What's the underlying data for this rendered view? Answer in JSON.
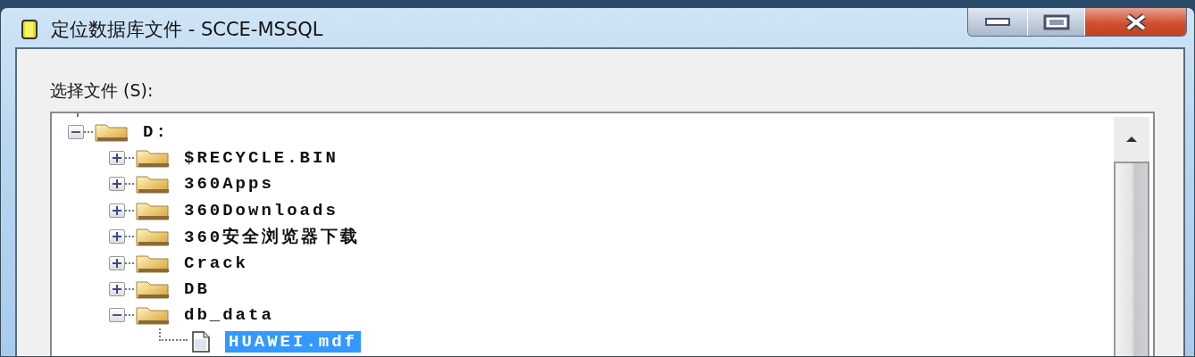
{
  "window": {
    "title": "定位数据库文件 - SCCE-MSSQL"
  },
  "select_label": "选择文件 (S):",
  "tree": [
    {
      "label": "D:",
      "kind": "folder",
      "expanded": true,
      "selected": false,
      "children": [
        {
          "label": "$RECYCLE.BIN",
          "kind": "folder",
          "expanded": false,
          "selected": false
        },
        {
          "label": "360Apps",
          "kind": "folder",
          "expanded": false,
          "selected": false
        },
        {
          "label": "360Downloads",
          "kind": "folder",
          "expanded": false,
          "selected": false
        },
        {
          "label": "360安全浏览器下载",
          "kind": "folder",
          "expanded": false,
          "selected": false
        },
        {
          "label": "Crack",
          "kind": "folder",
          "expanded": false,
          "selected": false
        },
        {
          "label": "DB",
          "kind": "folder",
          "expanded": false,
          "selected": false
        },
        {
          "label": "db_data",
          "kind": "folder",
          "expanded": true,
          "selected": false,
          "children": [
            {
              "label": "HUAWEI.mdf",
              "kind": "file",
              "selected": true
            }
          ]
        }
      ]
    }
  ]
}
